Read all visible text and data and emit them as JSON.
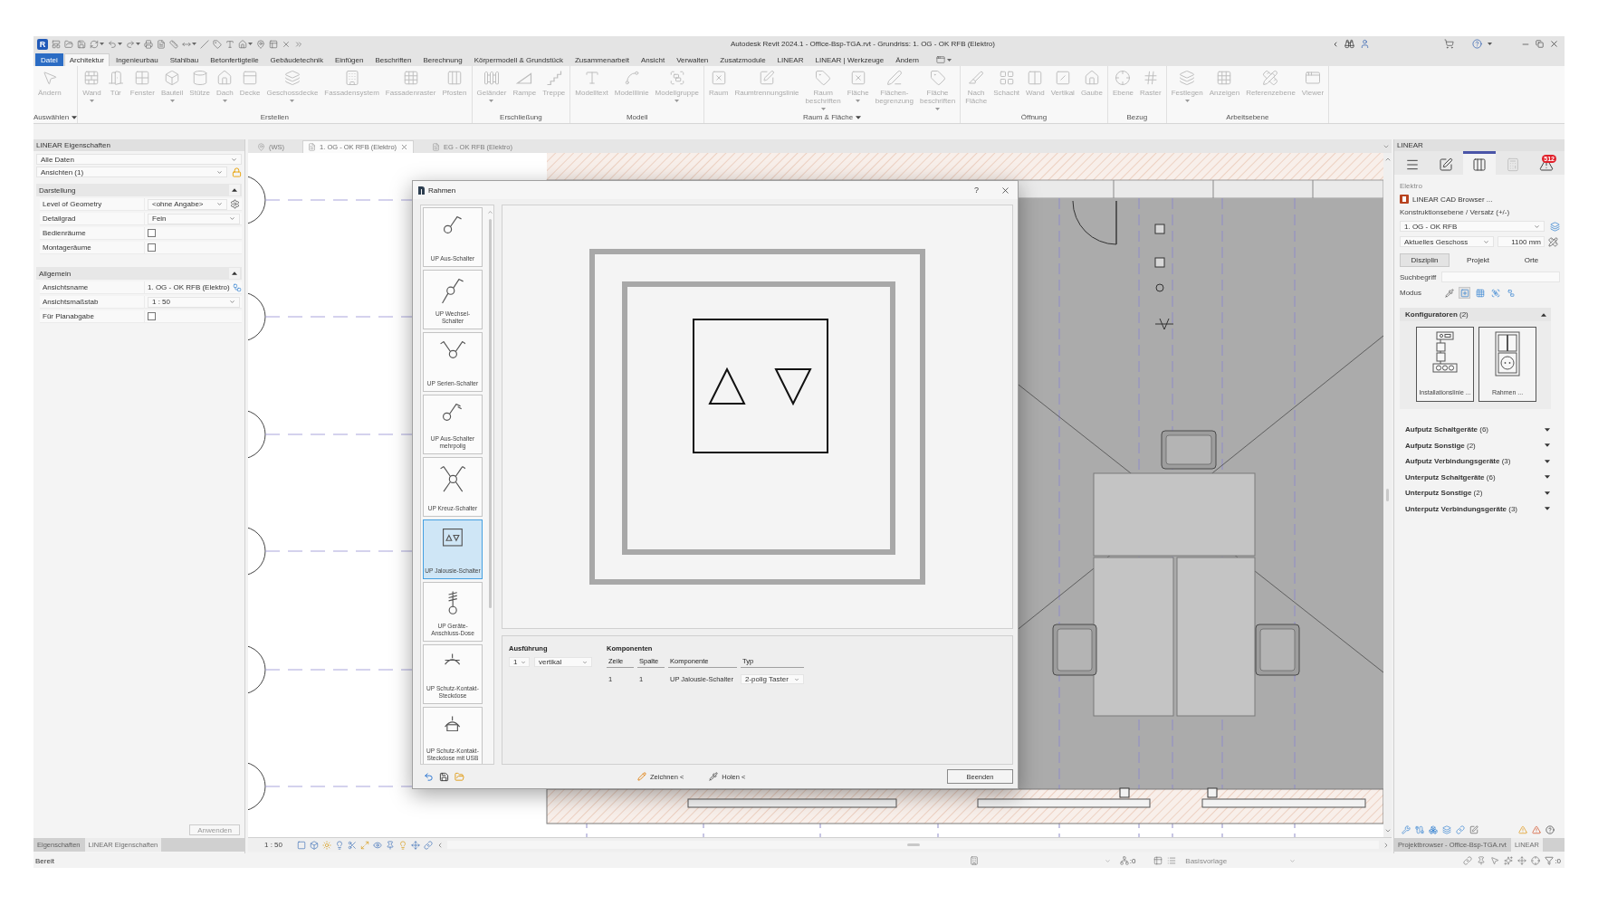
{
  "window": {
    "logo": "R",
    "title": "Autodesk Revit 2024.1 - Office-Bsp-TGA.rvt - Grundriss: 1. OG - OK RFB (Elektro)"
  },
  "ribbon_tabs": [
    {
      "label": "Datei",
      "kind": "file",
      "selected": false
    },
    {
      "label": "Architektur",
      "kind": "tab",
      "selected": true
    },
    {
      "label": "Ingenieurbau",
      "kind": "tab",
      "selected": false
    },
    {
      "label": "Stahlbau",
      "kind": "tab",
      "selected": false
    },
    {
      "label": "Betonfertigteile",
      "kind": "tab",
      "selected": false
    },
    {
      "label": "Gebäudetechnik",
      "kind": "tab",
      "selected": false
    },
    {
      "label": "Einfügen",
      "kind": "tab",
      "selected": false
    },
    {
      "label": "Beschriften",
      "kind": "tab",
      "selected": false
    },
    {
      "label": "Berechnung",
      "kind": "tab",
      "selected": false
    },
    {
      "label": "Körpermodell & Grundstück",
      "kind": "tab",
      "selected": false
    },
    {
      "label": "Zusammenarbeit",
      "kind": "tab",
      "selected": false
    },
    {
      "label": "Ansicht",
      "kind": "tab",
      "selected": false
    },
    {
      "label": "Verwalten",
      "kind": "tab",
      "selected": false
    },
    {
      "label": "Zusatzmodule",
      "kind": "tab",
      "selected": false
    },
    {
      "label": "LINEAR",
      "kind": "tab",
      "selected": false
    },
    {
      "label": "LINEAR | Werkzeuge",
      "kind": "tab",
      "selected": false
    },
    {
      "label": "Ändern",
      "kind": "tab",
      "selected": false
    }
  ],
  "ribbon_panels": [
    {
      "label": "Auswählen",
      "menu": true,
      "tools": [
        {
          "label": "Ändern",
          "dropdown": false,
          "disabled": true
        }
      ]
    },
    {
      "label": "Erstellen",
      "menu": false,
      "tools": [
        {
          "label": "Wand",
          "dropdown": true,
          "disabled": true
        },
        {
          "label": "Tür",
          "dropdown": false,
          "disabled": true
        },
        {
          "label": "Fenster",
          "dropdown": false,
          "disabled": true
        },
        {
          "label": "Bauteil",
          "dropdown": true,
          "disabled": true
        },
        {
          "label": "Stütze",
          "dropdown": false,
          "disabled": true
        },
        {
          "label": "Dach",
          "dropdown": true,
          "disabled": true
        },
        {
          "label": "Decke",
          "dropdown": false,
          "disabled": true
        },
        {
          "label": "Geschossdecke",
          "dropdown": true,
          "disabled": true
        },
        {
          "label": "Fassadensystem",
          "dropdown": false,
          "disabled": true
        },
        {
          "label": "Fassadenraster",
          "dropdown": false,
          "disabled": true
        },
        {
          "label": "Pfosten",
          "dropdown": false,
          "disabled": true
        }
      ]
    },
    {
      "label": "Erschließung",
      "menu": false,
      "tools": [
        {
          "label": "Geländer",
          "dropdown": true,
          "disabled": true
        },
        {
          "label": "Rampe",
          "dropdown": false,
          "disabled": true
        },
        {
          "label": "Treppe",
          "dropdown": false,
          "disabled": true
        }
      ]
    },
    {
      "label": "Modell",
      "menu": false,
      "tools": [
        {
          "label": "Modelltext",
          "dropdown": false,
          "disabled": true
        },
        {
          "label": "Modelllinie",
          "dropdown": false,
          "disabled": true
        },
        {
          "label": "Modellgruppe",
          "dropdown": true,
          "disabled": true
        }
      ]
    },
    {
      "label": "Raum & Fläche",
      "menu": true,
      "tools": [
        {
          "label": "Raum",
          "dropdown": false,
          "disabled": true
        },
        {
          "label": "Raumtrennungslinie",
          "dropdown": false,
          "disabled": true
        },
        {
          "label": "Raum beschriften",
          "dropdown": true,
          "disabled": true
        },
        {
          "label": "Fläche",
          "dropdown": true,
          "disabled": true
        },
        {
          "label": "Flächen-begrenzung",
          "dropdown": false,
          "disabled": true
        },
        {
          "label": "Fläche beschriften",
          "dropdown": true,
          "disabled": true
        }
      ]
    },
    {
      "label": "Öffnung",
      "menu": false,
      "tools": [
        {
          "label": "Nach Fläche",
          "dropdown": false,
          "disabled": true
        },
        {
          "label": "Schacht",
          "dropdown": false,
          "disabled": true
        },
        {
          "label": "Wand",
          "dropdown": false,
          "disabled": true
        },
        {
          "label": "Vertikal",
          "dropdown": false,
          "disabled": true
        },
        {
          "label": "Gaube",
          "dropdown": false,
          "disabled": true
        }
      ]
    },
    {
      "label": "Bezug",
      "menu": false,
      "tools": [
        {
          "label": "Ebene",
          "dropdown": false,
          "disabled": true
        },
        {
          "label": "Raster",
          "dropdown": false,
          "disabled": true
        }
      ]
    },
    {
      "label": "Arbeitsebene",
      "menu": false,
      "tools": [
        {
          "label": "Festlegen",
          "dropdown": true,
          "disabled": true
        },
        {
          "label": "Anzeigen",
          "dropdown": false,
          "disabled": true
        },
        {
          "label": "Referenzebene",
          "dropdown": false,
          "disabled": true
        },
        {
          "label": "Viewer",
          "dropdown": false,
          "disabled": true
        }
      ]
    }
  ],
  "properties": {
    "title": "LINEAR Eigenschaften",
    "filter": "Alle Daten",
    "selection": "Ansichten (1)",
    "sections": [
      {
        "title": "Darstellung",
        "expanded": true,
        "rows": [
          {
            "label": "Level of Geometry",
            "kind": "select-config",
            "value": "<ohne Angabe>"
          },
          {
            "label": "Detailgrad",
            "kind": "select",
            "value": "Fein"
          },
          {
            "label": "Bedienräume",
            "kind": "checkbox",
            "checked": false
          },
          {
            "label": "Montageräume",
            "kind": "checkbox",
            "checked": false
          }
        ]
      },
      {
        "title": "Allgemein",
        "expanded": true,
        "rows": [
          {
            "label": "Ansichtsname",
            "kind": "text-edit",
            "value": "1. OG - OK RFB (Elektro)"
          },
          {
            "label": "Ansichtsmaßstab",
            "kind": "select",
            "value": "1 : 50"
          },
          {
            "label": "Für Planabgabe",
            "kind": "checkbox",
            "checked": false
          }
        ]
      }
    ],
    "apply": {
      "label": "Anwenden",
      "disabled": true
    },
    "tabs": [
      {
        "label": "Eigenschaften",
        "selected": false
      },
      {
        "label": "LINEAR Eigenschaften",
        "selected": true
      }
    ]
  },
  "view": {
    "tabs": [
      {
        "label": "(WS)",
        "kind": "workset",
        "selected": false
      },
      {
        "label": "1. OG - OK RFB (Elektro)",
        "kind": "view",
        "selected": true
      },
      {
        "label": "EG - OK RFB (Elektro)",
        "kind": "view",
        "selected": false
      }
    ],
    "scale": "1 : 50"
  },
  "dialog": {
    "title": "Rahmen",
    "help": "?",
    "items": [
      {
        "label": "UP Aus-Schalter",
        "kind": "switch",
        "selected": false
      },
      {
        "label": "UP Wechsel-Schalter",
        "kind": "two-way",
        "selected": false
      },
      {
        "label": "UP Serien-Schalter",
        "kind": "series",
        "selected": false
      },
      {
        "label": "UP Aus-Schalter mehrpolig",
        "kind": "multipole",
        "selected": false
      },
      {
        "label": "UP Kreuz-Schalter",
        "kind": "cross",
        "selected": false
      },
      {
        "label": "UP Jalousie-Schalter",
        "kind": "blind",
        "selected": true
      },
      {
        "label": "UP Geräte-Anschluss-Dose",
        "kind": "device-box",
        "selected": false
      },
      {
        "label": "UP Schutz-Kontakt-Steckdose",
        "kind": "socket",
        "selected": false
      },
      {
        "label": "UP Schutz-Kontakt-Steckdose mit USB",
        "kind": "usb-socket",
        "selected": false
      }
    ],
    "execution": {
      "label": "Ausführung",
      "count": "1",
      "orientation": "vertikal"
    },
    "components": {
      "label": "Komponenten",
      "columns": [
        "Zeile",
        "Spalte",
        "Komponente",
        "Typ"
      ],
      "rows": [
        {
          "row": "1",
          "column": "1",
          "component": "UP Jalousie-Schalter",
          "type": "2-polig Taster"
        }
      ]
    },
    "buttons": {
      "draw": "Zeichnen <",
      "pick": "Holen <",
      "finish": "Beenden"
    }
  },
  "linear_panel": {
    "title": "LINEAR",
    "toolbar": [
      {
        "selected": false,
        "disabled": false
      },
      {
        "selected": false,
        "disabled": false
      },
      {
        "selected": true,
        "disabled": false
      },
      {
        "selected": false,
        "disabled": true
      },
      {
        "selected": false,
        "disabled": false,
        "badge": "512"
      }
    ],
    "discipline": "Elektro",
    "browser_link": "LINEAR CAD Browser ...",
    "level_label": "Konstruktionsebene / Versatz (+/-)",
    "level": "1. OG - OK RFB",
    "storey": "Aktuelles Geschoss",
    "offset": "1100 mm",
    "scopes": [
      {
        "label": "Disziplin",
        "selected": true
      },
      {
        "label": "Projekt",
        "selected": false
      },
      {
        "label": "Orte",
        "selected": false
      }
    ],
    "search_label": "Suchbegriff",
    "mode_label": "Modus",
    "modes": [
      {
        "selected": false
      },
      {
        "selected": true
      },
      {
        "selected": false
      },
      {
        "selected": false
      },
      {
        "selected": false
      }
    ],
    "configurators": {
      "title": "**Konfiguratoren** (2)",
      "expanded": true,
      "items": [
        {
          "label": "Installationslinie ...",
          "kind": "line"
        },
        {
          "label": "Rahmen ...",
          "kind": "frame"
        }
      ]
    },
    "groups": [
      {
        "title": "**Aufputz Schaltgeräte** (6)",
        "expanded": false
      },
      {
        "title": "**Aufputz Sonstige** (2)",
        "expanded": false
      },
      {
        "title": "**Aufputz Verbindungsgeräte** (3)",
        "expanded": false
      },
      {
        "title": "**Unterputz Schaltgeräte** (6)",
        "expanded": false
      },
      {
        "title": "**Unterputz Sonstige** (2)",
        "expanded": false
      },
      {
        "title": "**Unterputz Verbindungsgeräte** (3)",
        "expanded": false
      }
    ],
    "tabs": [
      {
        "label": "Projektbrowser - Office-Bsp-TGA.rvt",
        "selected": false
      },
      {
        "label": "LINEAR",
        "selected": true
      }
    ]
  },
  "status_bar": {
    "text": "Bereit",
    "counter": ":0",
    "design_option": "Basisvorlage",
    "filter_count": ":0"
  }
}
